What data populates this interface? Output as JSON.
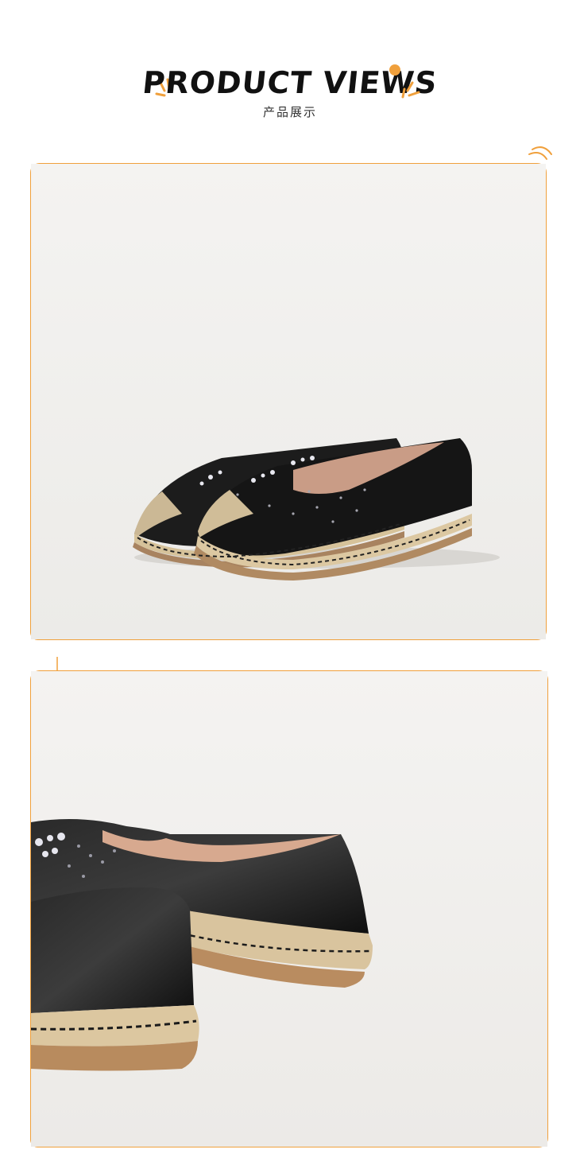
{
  "header": {
    "title": "PRODUCT VIEWS",
    "subtitle": "产品展示"
  },
  "colors": {
    "accent": "#f0a03c",
    "photo_background": "#f3f2f0",
    "shoe_upper": "#151515",
    "jute_sole": "#d9c4a0",
    "rubber_outsole": "#b58a62"
  },
  "images": [
    {
      "name": "product-photo-pair-front",
      "description_icon": "espadrille-shoe-pair"
    },
    {
      "name": "product-photo-heel-closeup",
      "description_icon": "espadrille-shoe-heel"
    }
  ]
}
